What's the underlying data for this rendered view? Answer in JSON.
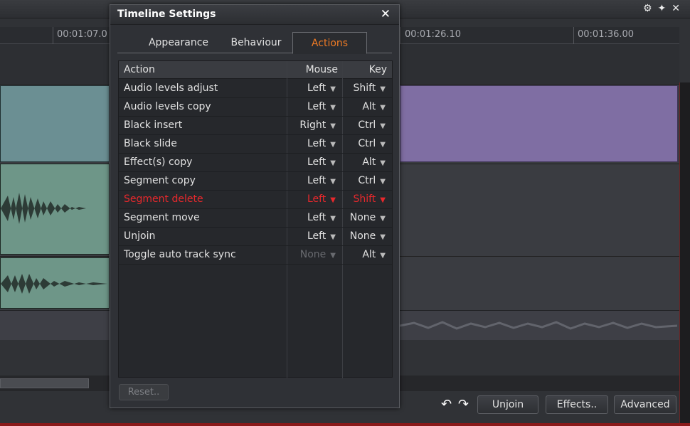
{
  "timeline": {
    "timecodes": [
      "00:01:07.0",
      "00:01:26.10",
      "00:01:36.00"
    ]
  },
  "dialog": {
    "title": "Timeline Settings",
    "close_icon": "close-icon",
    "tabs": [
      {
        "label": "Appearance",
        "active": false
      },
      {
        "label": "Behaviour",
        "active": false
      },
      {
        "label": "Actions",
        "active": true
      }
    ],
    "table": {
      "headers": {
        "action": "Action",
        "mouse": "Mouse",
        "key": "Key"
      },
      "rows": [
        {
          "action": "Audio levels adjust",
          "mouse": "Left",
          "key": "Shift"
        },
        {
          "action": "Audio levels copy",
          "mouse": "Left",
          "key": "Alt"
        },
        {
          "action": "Black insert",
          "mouse": "Right",
          "key": "Ctrl"
        },
        {
          "action": "Black slide",
          "mouse": "Left",
          "key": "Ctrl"
        },
        {
          "action": "Effect(s) copy",
          "mouse": "Left",
          "key": "Alt"
        },
        {
          "action": "Segment copy",
          "mouse": "Left",
          "key": "Ctrl"
        },
        {
          "action": "Segment delete",
          "mouse": "Left",
          "key": "Shift",
          "selected": true
        },
        {
          "action": "Segment move",
          "mouse": "Left",
          "key": "None"
        },
        {
          "action": "Unjoin",
          "mouse": "Left",
          "key": "None"
        },
        {
          "action": "Toggle auto track sync",
          "mouse": "None",
          "key": "Alt",
          "mouse_disabled": true
        }
      ]
    },
    "reset_label": "Reset.."
  },
  "bottom_bar": {
    "unjoin_label": "Unjoin",
    "effects_label": "Effects..",
    "advanced_label": "Advanced"
  },
  "colors": {
    "accent_orange": "#f07b24",
    "selected_red": "#e8282c",
    "clip_purple": "#7f6ea3",
    "clip_teal": "#6b8f93"
  }
}
